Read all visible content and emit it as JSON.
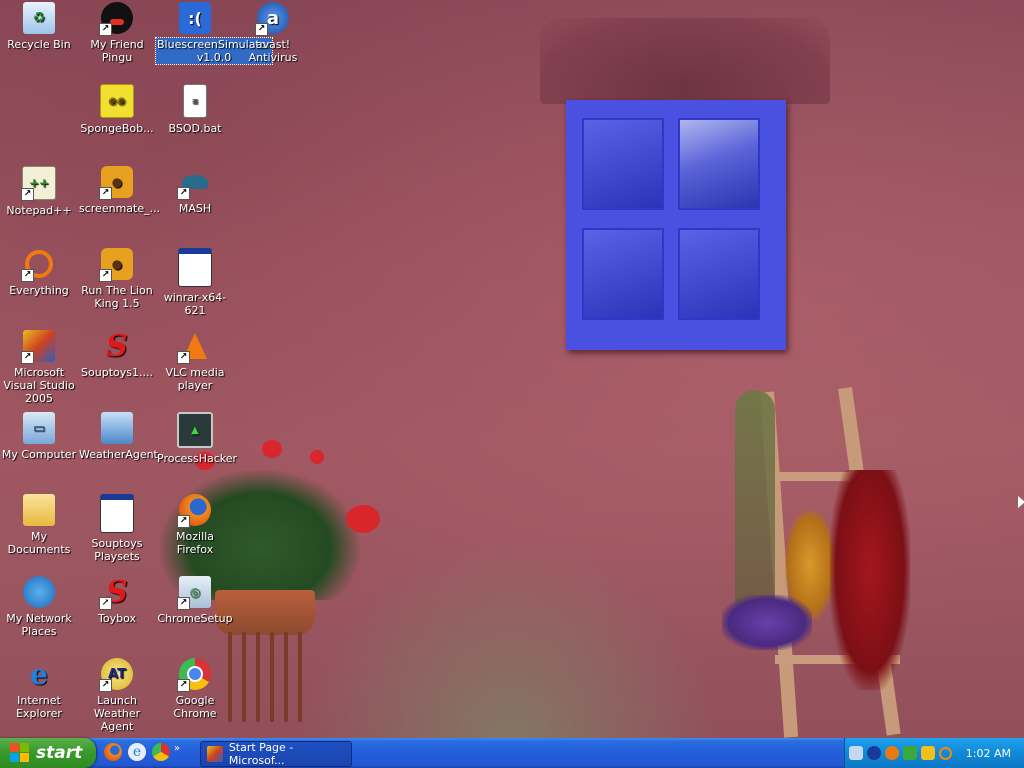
{
  "desktop": {
    "icons": [
      {
        "label": "Recycle Bin",
        "icon": "recycle-bin-icon"
      },
      {
        "label": "My Friend Pingu",
        "icon": "pingu-icon"
      },
      {
        "label": "BluescreenSimulator v1.0.0",
        "icon": "bluescreen-icon"
      },
      {
        "label": "avast! Antivirus",
        "icon": "avast-icon"
      },
      {
        "label": "SpongeBob...",
        "icon": "spongebob-icon"
      },
      {
        "label": "BSOD.bat",
        "icon": "batch-file-icon"
      },
      {
        "label": "Notepad++",
        "icon": "notepad-plus-plus-icon"
      },
      {
        "label": "screenmate_...",
        "icon": "screenmate-icon"
      },
      {
        "label": "MASH",
        "icon": "mash-icon"
      },
      {
        "label": "Everything",
        "icon": "everything-search-icon"
      },
      {
        "label": "Run The Lion King 1.5",
        "icon": "lion-king-icon"
      },
      {
        "label": "winrar-x64-621",
        "icon": "winrar-installer-icon"
      },
      {
        "label": "Microsoft Visual Studio 2005",
        "icon": "visual-studio-icon"
      },
      {
        "label": "Souptoys1....",
        "icon": "souptoys-icon"
      },
      {
        "label": "VLC media player",
        "icon": "vlc-icon"
      },
      {
        "label": "My Computer",
        "icon": "my-computer-icon"
      },
      {
        "label": "WeatherAgent",
        "icon": "weatheragent-icon"
      },
      {
        "label": "ProcessHacker",
        "icon": "processhacker-icon"
      },
      {
        "label": "My Documents",
        "icon": "my-documents-icon"
      },
      {
        "label": "Souptoys Playsets",
        "icon": "souptoys-playsets-icon"
      },
      {
        "label": "Mozilla Firefox",
        "icon": "firefox-icon"
      },
      {
        "label": "My Network Places",
        "icon": "network-places-icon"
      },
      {
        "label": "Toybox",
        "icon": "toybox-icon"
      },
      {
        "label": "ChromeSetup",
        "icon": "chrome-setup-icon"
      },
      {
        "label": "Internet Explorer",
        "icon": "internet-explorer-icon"
      },
      {
        "label": "Launch Weather Agent",
        "icon": "launch-weather-agent-icon"
      },
      {
        "label": "Google Chrome",
        "icon": "google-chrome-icon"
      }
    ],
    "selected_label": "BluescreenSimulator v1.0.0"
  },
  "taskbar": {
    "start_label": "start",
    "quick_launch": [
      "firefox-icon",
      "internet-explorer-icon",
      "google-chrome-icon"
    ],
    "quick_launch_more": "»",
    "tasks": [
      {
        "label": "Start Page - Microsof...",
        "icon": "visual-studio-icon"
      }
    ],
    "tray_icons": [
      "network-icon",
      "info-icon",
      "avast-icon",
      "shield-icon",
      "connection-icon",
      "search-icon"
    ],
    "clock": "1:02 AM"
  },
  "colors": {
    "taskbar_blue": "#245edb",
    "start_green": "#3a9a2c",
    "tray_blue": "#108ad6",
    "selection_blue": "#316ac5"
  }
}
